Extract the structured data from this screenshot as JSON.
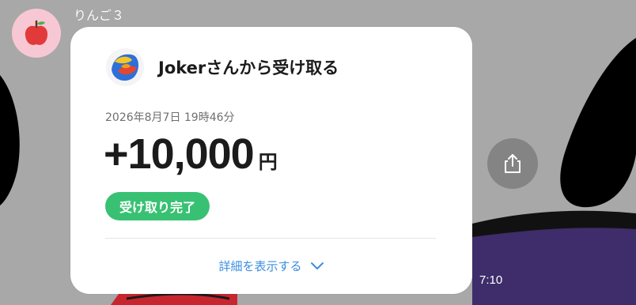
{
  "sender": {
    "name": "りんご３",
    "avatar_icon": "apple-icon"
  },
  "card": {
    "title": "Jokerさんから受け取る",
    "date": "2026年8月7日 19時46分",
    "amount": "+10,000",
    "currency": "円",
    "status": "受け取り完了",
    "details_label": "詳細を表示する",
    "logo_icon": "paypay-style-logo-icon"
  },
  "message": {
    "time": "7:10"
  },
  "share_icon": "share-icon",
  "colors": {
    "accent_green": "#39c173",
    "link_blue": "#3b8ee0",
    "background_gray": "#a9a9a9"
  }
}
